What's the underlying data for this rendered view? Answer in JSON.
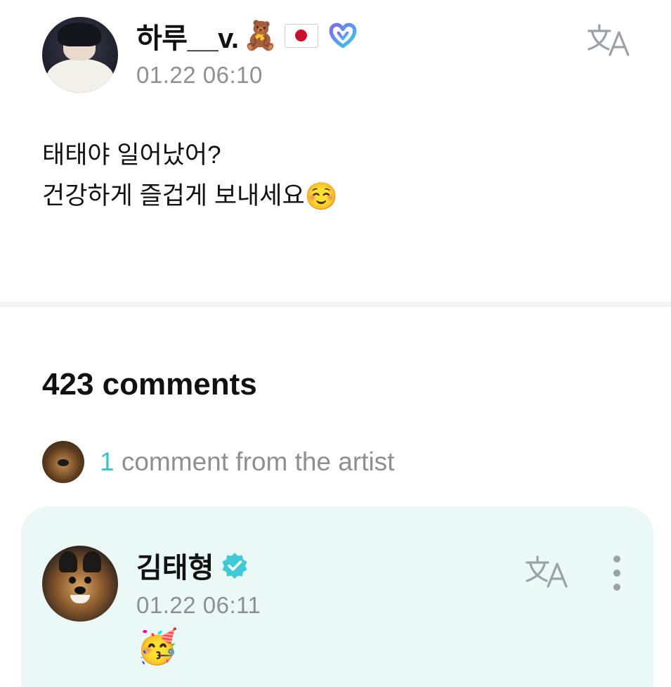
{
  "post": {
    "author": {
      "name": "하루__v.",
      "emojis": [
        "🧸"
      ],
      "flag": "japan-flag",
      "badge": "weverse-heart-icon"
    },
    "timestamp": "01.22 06:10",
    "body_lines": [
      "태태야 일어났어?",
      "건강하게 즐겁게 보내세요"
    ],
    "body_emoji": "☺️",
    "translate_icon": "translate-icon"
  },
  "comments": {
    "count_label": "423 comments",
    "artist_summary": {
      "count": "1",
      "label": " comment from the artist"
    }
  },
  "artist_comment": {
    "name": "김태형",
    "verified_icon": "verified-badge-icon",
    "timestamp": "01.22 06:11",
    "text": "🥳",
    "translate_icon": "translate-icon",
    "more_icon": "more-vertical-icon"
  },
  "colors": {
    "accent": "#38c3cc",
    "card_background": "#eaf8f6",
    "muted_text": "#8e8e93",
    "icon_gray": "#9aa2a8"
  }
}
